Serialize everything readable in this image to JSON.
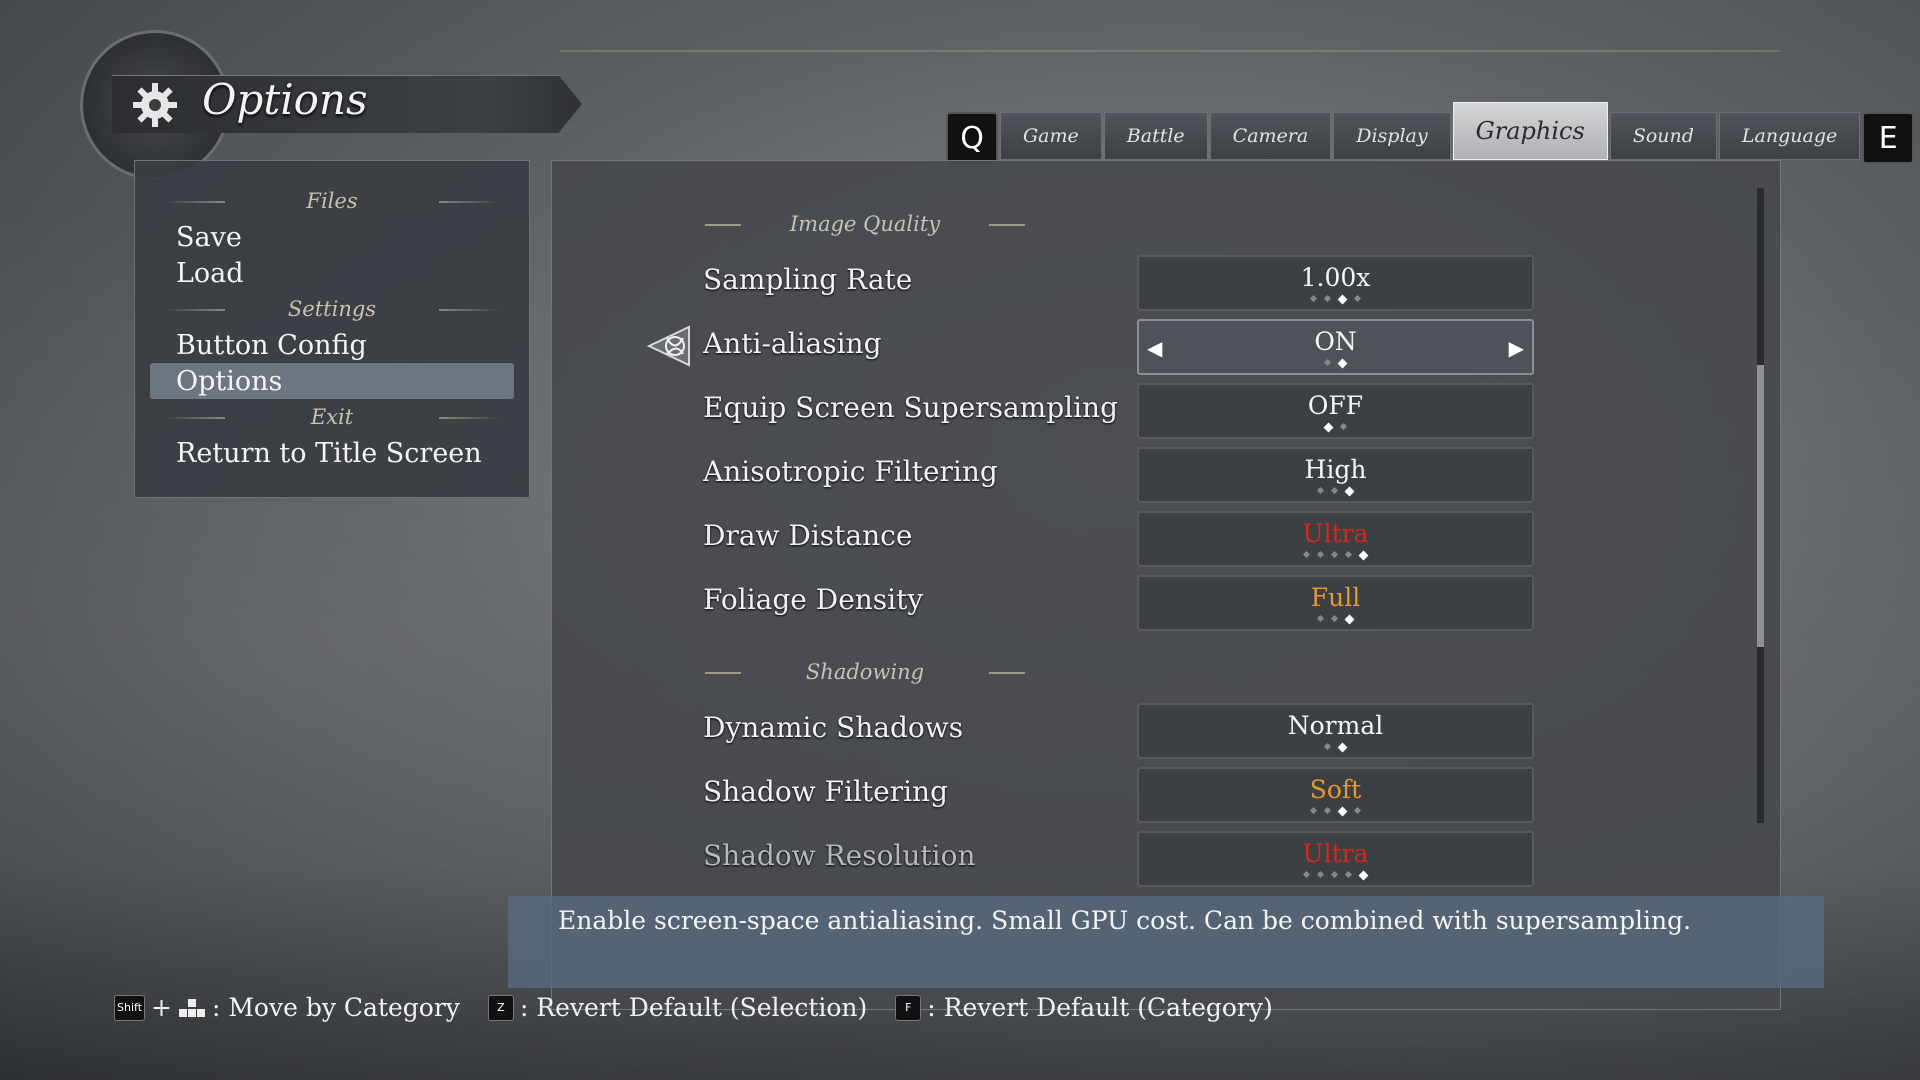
{
  "header": {
    "title": "Options"
  },
  "tabs": {
    "prev_key": "Q",
    "next_key": "E",
    "items": [
      "Game",
      "Battle",
      "Camera",
      "Display",
      "Graphics",
      "Sound",
      "Language"
    ],
    "active": "Graphics"
  },
  "left_menu": {
    "files_header": "Files",
    "save": "Save",
    "load": "Load",
    "settings_header": "Settings",
    "button_config": "Button Config",
    "options": "Options",
    "exit_header": "Exit",
    "return_title": "Return to Title Screen"
  },
  "sections": {
    "image_quality": "Image Quality",
    "shadowing": "Shadowing"
  },
  "settings": [
    {
      "label": "Sampling Rate",
      "value": "1.00x",
      "color": "#f5f5f5",
      "steps": 4,
      "selected_step": 2
    },
    {
      "label": "Anti-aliasing",
      "value": "ON",
      "color": "#f5f5f5",
      "steps": 2,
      "selected_step": 1
    },
    {
      "label": "Equip Screen Supersampling",
      "value": "OFF",
      "color": "#f5f5f5",
      "steps": 2,
      "selected_step": 0
    },
    {
      "label": "Anisotropic Filtering",
      "value": "High",
      "color": "#f5f5f5",
      "steps": 3,
      "selected_step": 2
    },
    {
      "label": "Draw Distance",
      "value": "Ultra",
      "color": "#d52a1c",
      "steps": 5,
      "selected_step": 4
    },
    {
      "label": "Foliage Density",
      "value": "Full",
      "color": "#e79a2c",
      "steps": 3,
      "selected_step": 2
    },
    {
      "label": "Dynamic Shadows",
      "value": "Normal",
      "color": "#f5f5f5",
      "steps": 2,
      "selected_step": 1
    },
    {
      "label": "Shadow Filtering",
      "value": "Soft",
      "color": "#e79a2c",
      "steps": 4,
      "selected_step": 2
    },
    {
      "label": "Shadow Resolution",
      "value": "Ultra",
      "color": "#d52a1c",
      "steps": 5,
      "selected_step": 4
    }
  ],
  "description": "Enable screen-space antialiasing. Small GPU cost. Can be combined with supersampling.",
  "footer": {
    "shift_key": "Shift",
    "plus": "+",
    "move_category": ": Move by Category",
    "z_key": "Z",
    "revert_selection": ": Revert Default (Selection)",
    "f_key": "F",
    "revert_category": ": Revert Default (Category)"
  }
}
